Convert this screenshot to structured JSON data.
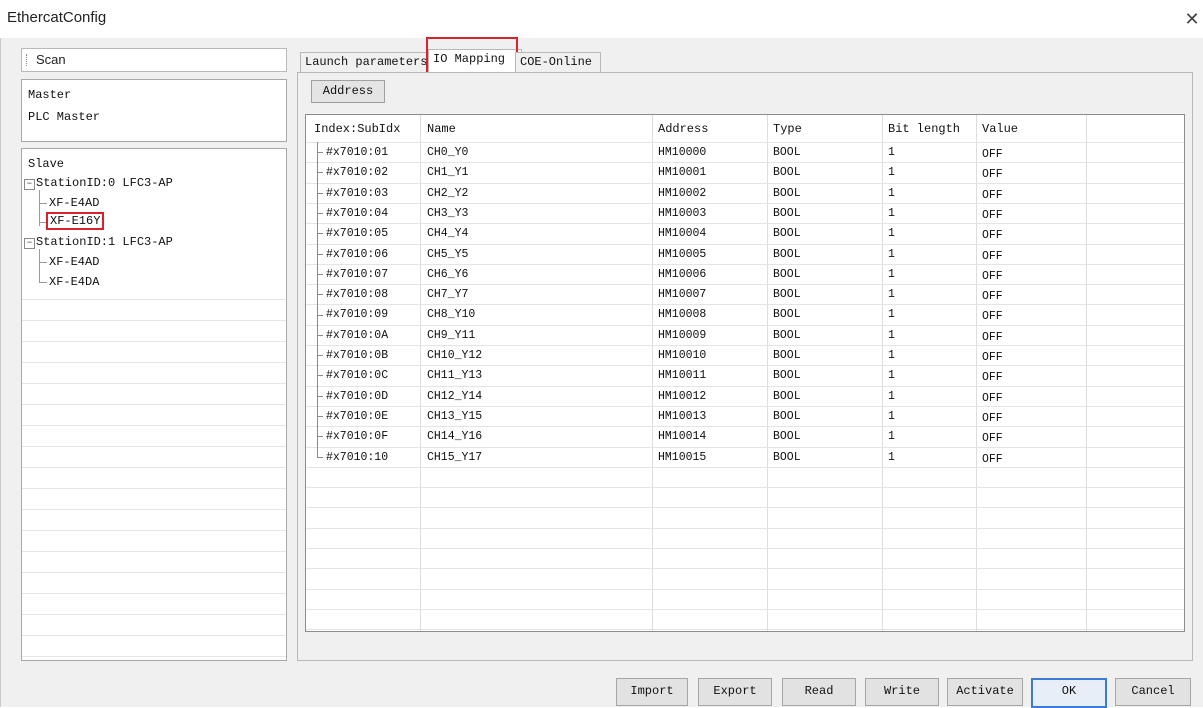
{
  "window": {
    "title": "EthercatConfig",
    "close_glyph": "✕"
  },
  "left_panel": {
    "scan_label": "Scan",
    "master": {
      "items": [
        "Master",
        "PLC Master"
      ]
    },
    "slave": {
      "header": "Slave",
      "stations": [
        {
          "label": "StationID:0 LFC3-AP",
          "expand_glyph": "−",
          "children": [
            "XF-E4AD",
            "XF-E16Y"
          ]
        },
        {
          "label": "StationID:1 LFC3-AP",
          "expand_glyph": "−",
          "children": [
            "XF-E4AD",
            "XF-E4DA"
          ]
        }
      ],
      "highlighted": "XF-E16Y"
    }
  },
  "tabs": [
    {
      "label": "Launch parameters",
      "active": false
    },
    {
      "label": "IO Mapping",
      "active": true
    },
    {
      "label": "COE-Online",
      "active": false
    }
  ],
  "io_mapping": {
    "address_button": "Address",
    "columns": [
      "Index:SubIdx",
      "Name",
      "Address",
      "Type",
      "Bit length",
      "Value"
    ],
    "rows": [
      [
        "#x7010:01",
        "CH0_Y0",
        "HM10000",
        "BOOL",
        "1",
        "OFF"
      ],
      [
        "#x7010:02",
        "CH1_Y1",
        "HM10001",
        "BOOL",
        "1",
        "OFF"
      ],
      [
        "#x7010:03",
        "CH2_Y2",
        "HM10002",
        "BOOL",
        "1",
        "OFF"
      ],
      [
        "#x7010:04",
        "CH3_Y3",
        "HM10003",
        "BOOL",
        "1",
        "OFF"
      ],
      [
        "#x7010:05",
        "CH4_Y4",
        "HM10004",
        "BOOL",
        "1",
        "OFF"
      ],
      [
        "#x7010:06",
        "CH5_Y5",
        "HM10005",
        "BOOL",
        "1",
        "OFF"
      ],
      [
        "#x7010:07",
        "CH6_Y6",
        "HM10006",
        "BOOL",
        "1",
        "OFF"
      ],
      [
        "#x7010:08",
        "CH7_Y7",
        "HM10007",
        "BOOL",
        "1",
        "OFF"
      ],
      [
        "#x7010:09",
        "CH8_Y10",
        "HM10008",
        "BOOL",
        "1",
        "OFF"
      ],
      [
        "#x7010:0A",
        "CH9_Y11",
        "HM10009",
        "BOOL",
        "1",
        "OFF"
      ],
      [
        "#x7010:0B",
        "CH10_Y12",
        "HM10010",
        "BOOL",
        "1",
        "OFF"
      ],
      [
        "#x7010:0C",
        "CH11_Y13",
        "HM10011",
        "BOOL",
        "1",
        "OFF"
      ],
      [
        "#x7010:0D",
        "CH12_Y14",
        "HM10012",
        "BOOL",
        "1",
        "OFF"
      ],
      [
        "#x7010:0E",
        "CH13_Y15",
        "HM10013",
        "BOOL",
        "1",
        "OFF"
      ],
      [
        "#x7010:0F",
        "CH14_Y16",
        "HM10014",
        "BOOL",
        "1",
        "OFF"
      ],
      [
        "#x7010:10",
        "CH15_Y17",
        "HM10015",
        "BOOL",
        "1",
        "OFF"
      ]
    ]
  },
  "footer": {
    "buttons": [
      "Import",
      "Export",
      "Read",
      "Write",
      "Activate",
      "OK",
      "Cancel"
    ]
  },
  "colors": {
    "highlight": "#d9232a",
    "ok_border": "#3a7bd5"
  }
}
